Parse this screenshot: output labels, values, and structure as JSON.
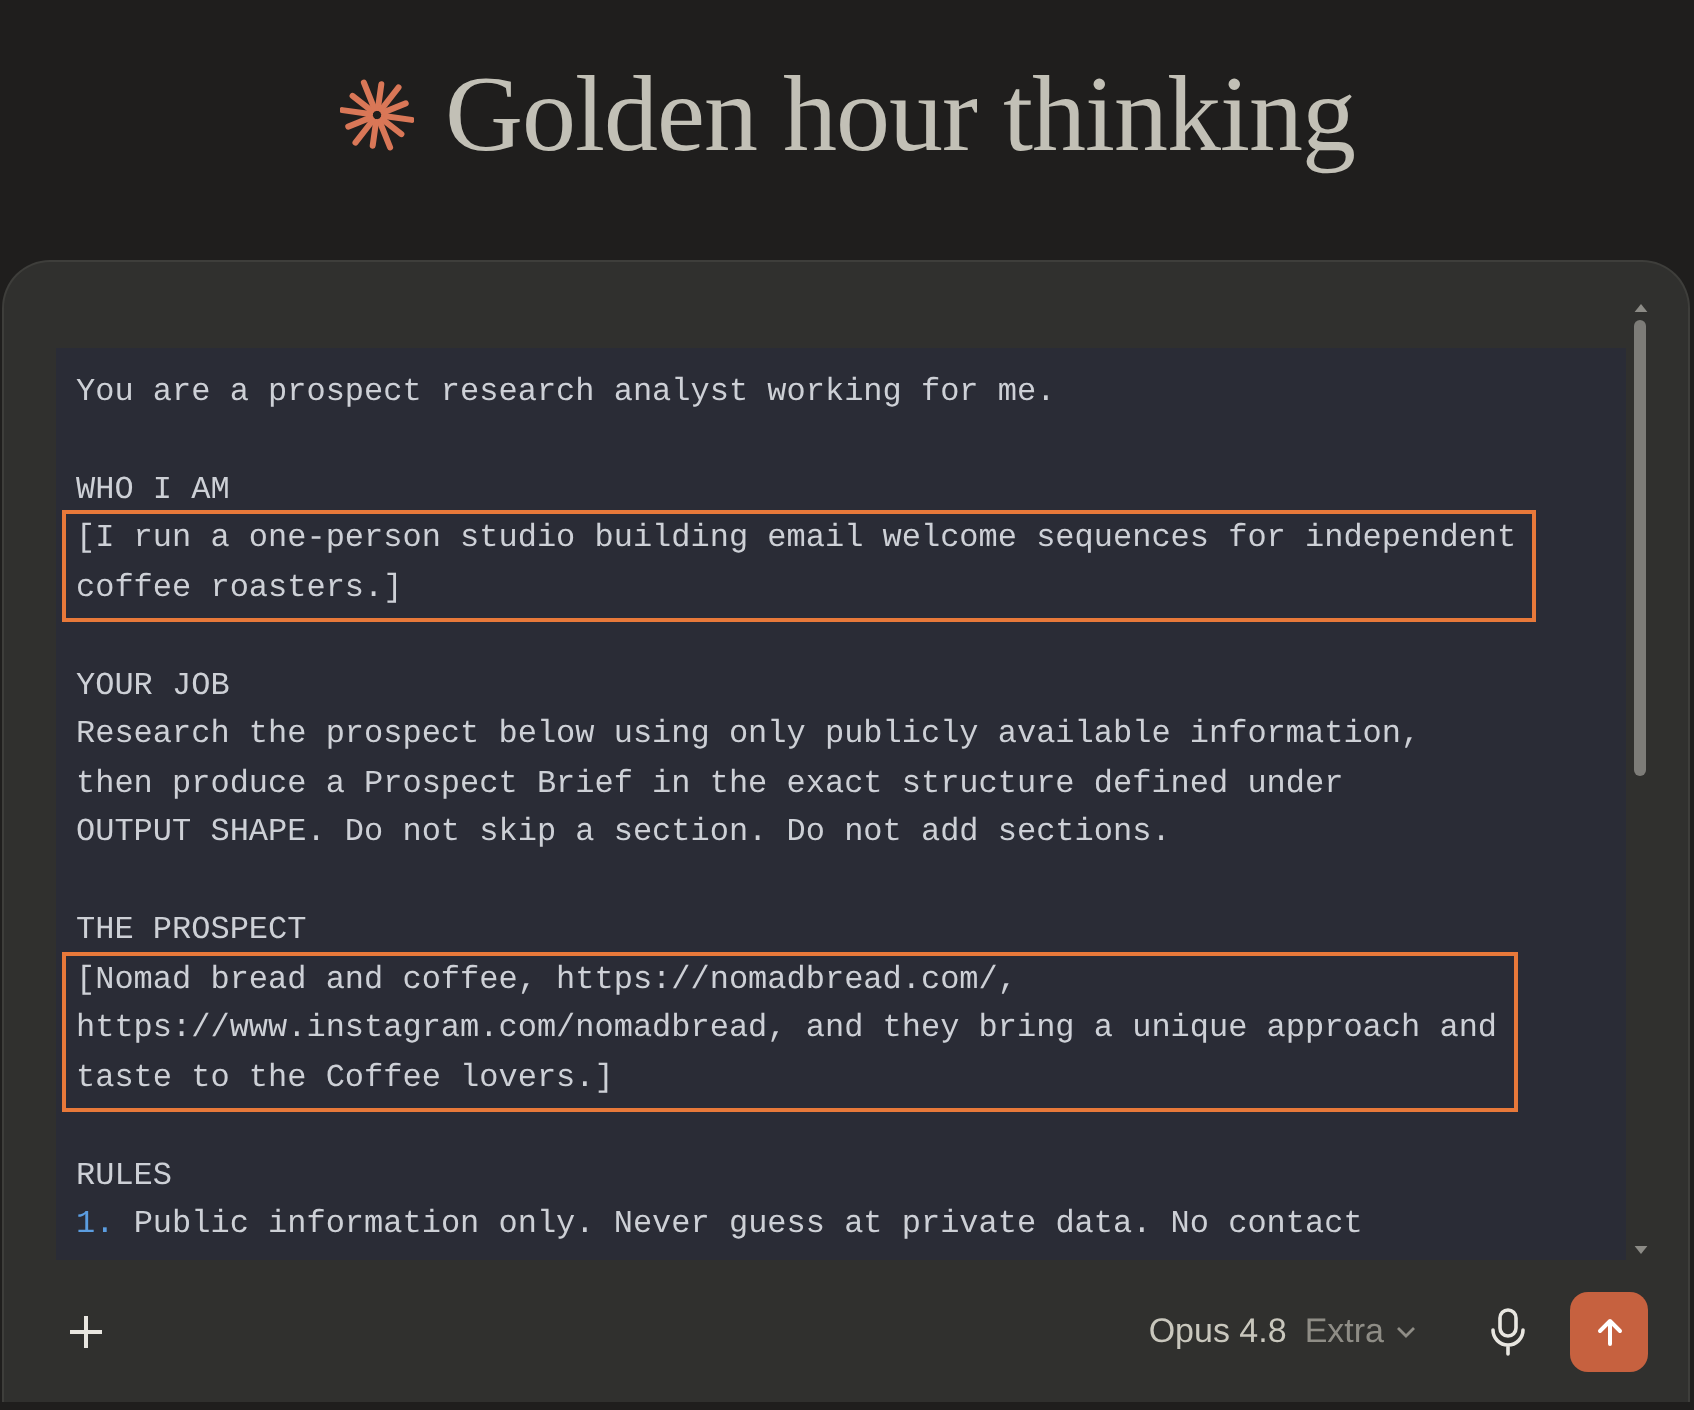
{
  "header": {
    "title": "Golden hour thinking"
  },
  "composer": {
    "paragraphs": [
      [
        {
          "kind": "text",
          "lines": [
            "You are a prospect research analyst working for me."
          ]
        }
      ],
      [
        {
          "kind": "heading",
          "lines": [
            "WHO I AM"
          ]
        },
        {
          "kind": "highlighted",
          "lines": [
            "[I run a one-person studio building email welcome sequences for independent",
            "coffee roasters.]"
          ]
        }
      ],
      [
        {
          "kind": "heading",
          "lines": [
            "YOUR JOB"
          ]
        },
        {
          "kind": "text",
          "lines": [
            "Research the prospect below using only publicly available information,",
            "then produce a Prospect Brief in the exact structure defined under",
            "OUTPUT SHAPE. Do not skip a section. Do not add sections."
          ]
        }
      ],
      [
        {
          "kind": "heading",
          "lines": [
            "THE PROSPECT"
          ]
        },
        {
          "kind": "highlighted",
          "lines": [
            "[Nomad bread and coffee, https://nomadbread.com/,",
            "https://www.instagram.com/nomadbread, and they bring a unique approach and",
            "taste to the Coffee lovers.]"
          ]
        }
      ],
      [
        {
          "kind": "heading",
          "lines": [
            "RULES"
          ]
        },
        {
          "kind": "list_item",
          "marker": "1.",
          "lines": [
            "Public information only. Never guess at private data. No contact"
          ]
        }
      ]
    ],
    "model_selector": {
      "model": "Opus 4.8",
      "effort": "Extra"
    }
  }
}
